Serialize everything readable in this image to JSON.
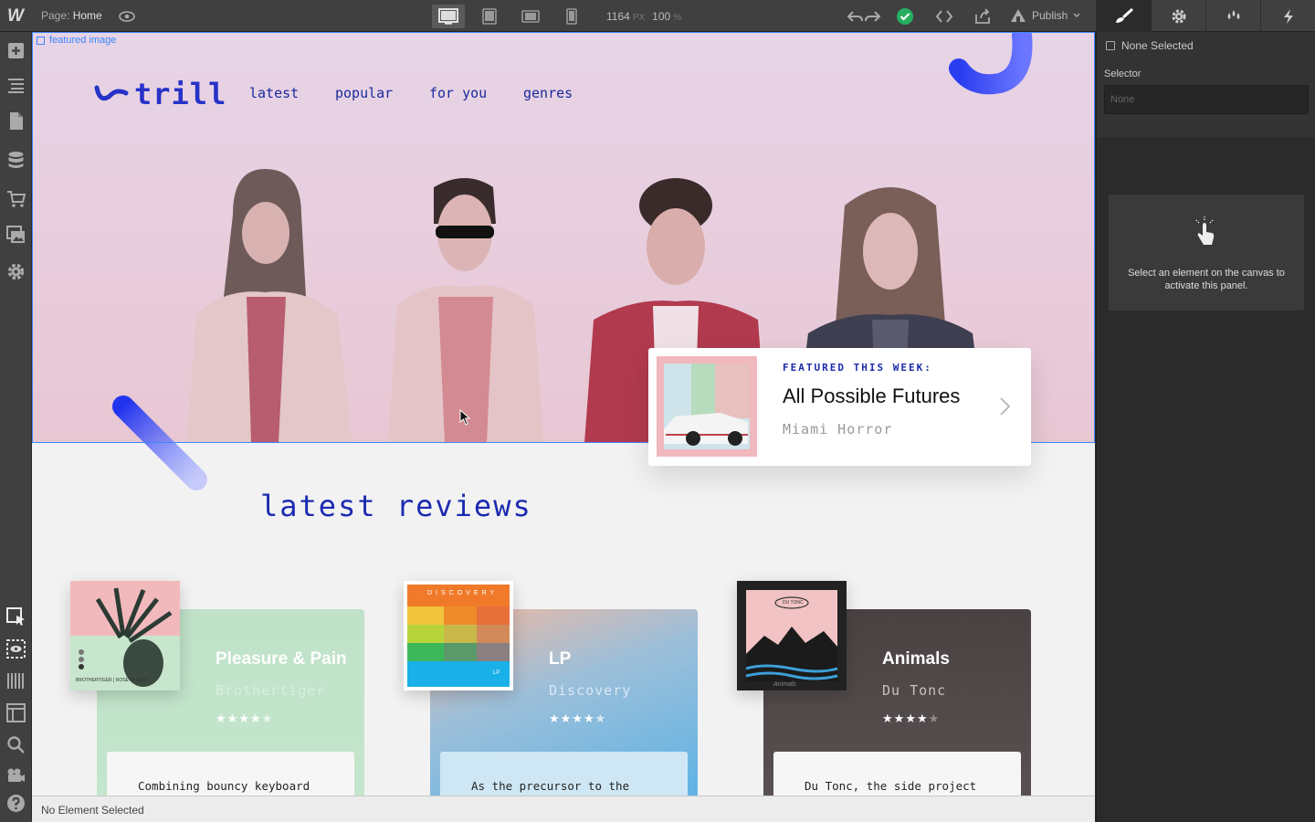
{
  "topbar": {
    "logo": "W",
    "page_label": "Page:",
    "page_name": "Home",
    "canvas_width": "1164",
    "width_unit": "PX",
    "zoom": "100",
    "zoom_unit": "%",
    "publish_label": "Publish"
  },
  "canvas": {
    "selection_tag": "featured image",
    "logo_text": "trill",
    "nav": [
      "latest",
      "popular",
      "for you",
      "genres"
    ],
    "featured": {
      "label": "FEATURED THIS WEEK:",
      "title": "All Possible Futures",
      "artist": "Miami Horror"
    },
    "section_title": "latest reviews",
    "reviews": [
      {
        "title": "Pleasure & Pain",
        "artist": "Brothertiger",
        "rating": 4.5,
        "stars": "★★★★★",
        "excerpt": "Combining bouncy keyboard",
        "cover_text": "BROTHERTIGER | ROSE QUARTZ"
      },
      {
        "title": "LP",
        "artist": "Discovery",
        "rating": 4.5,
        "stars": "★★★★★",
        "excerpt": "As the precursor to the",
        "cover_text": "DISCOVERY",
        "cover_badge": "LP"
      },
      {
        "title": "Animals",
        "artist": "Du Tonc",
        "rating": 4,
        "stars": "★★★★★",
        "excerpt": "Du Tonc, the side project",
        "cover_text": "DU TONC",
        "cover_script": "Animals"
      }
    ]
  },
  "status_bar": "No Element Selected",
  "right_panel": {
    "none_selected": "None Selected",
    "selector_label": "Selector",
    "selector_placeholder": "None",
    "hint": "Select an element on the canvas to activate this panel."
  },
  "colors": {
    "brand_blue": "#2732c8",
    "selection_blue": "#3d86ff",
    "publish_ok": "#27ae60"
  }
}
